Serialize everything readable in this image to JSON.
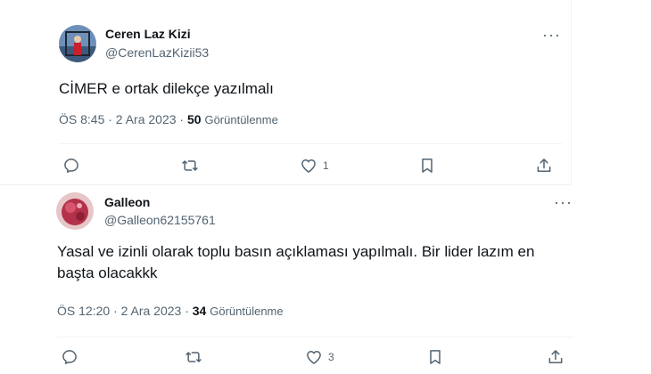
{
  "tweets": [
    {
      "name": "Ceren Laz Kizi",
      "handle": "@CerenLazKizii53",
      "text": "CİMER e ortak dilekçe yazılmalı",
      "time": "ÖS 8:45 · 2 Ara 2023 · ",
      "views": "50",
      "views_label": "Görüntülenme",
      "like_count": "1"
    },
    {
      "name": "Galleon",
      "handle": "@Galleon62155761",
      "text_line1": "Yasal ve izinli olarak toplu basın açıklaması yapılmalı. Bir lider lazım en",
      "text_line2": "başta olacakkk",
      "time": "ÖS 12:20 · 2 Ara 2023 · ",
      "views": "34",
      "views_label": "Görüntülenme",
      "like_count": "3"
    }
  ],
  "more_glyph": "···",
  "icons": [
    "reply-icon",
    "retweet-icon",
    "like-icon",
    "bookmark-icon",
    "share-icon",
    "more-icon"
  ],
  "colors": {
    "text": "#0f1419",
    "secondary": "#536471",
    "divider": "#eff3f4"
  }
}
